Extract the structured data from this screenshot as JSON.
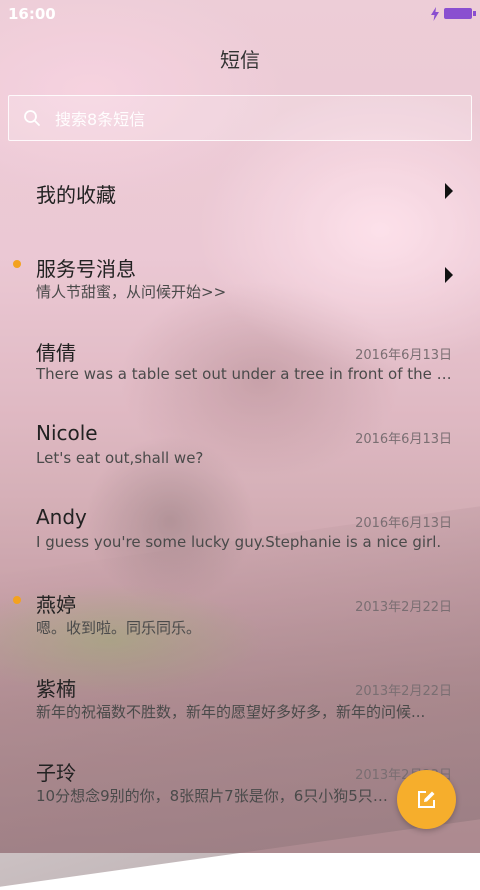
{
  "status_bar": {
    "time": "16:00"
  },
  "header": {
    "title": "短信"
  },
  "search": {
    "placeholder": "搜索8条短信"
  },
  "conversations": [
    {
      "name": "我的收藏",
      "has_arrow": true
    },
    {
      "name": "服务号消息",
      "preview": "情人节甜蜜，从问候开始>>",
      "unread": true,
      "has_arrow": true
    },
    {
      "name": "倩倩",
      "preview": "There was a table set out under a tree in front of the ho...",
      "date": "2016年6月13日"
    },
    {
      "name": "Nicole",
      "preview": "Let's eat out,shall we?",
      "date": "2016年6月13日"
    },
    {
      "name": "Andy",
      "preview": "I guess you're some lucky guy.Stephanie is a nice girl.",
      "date": "2016年6月13日"
    },
    {
      "name": "燕婷",
      "preview": "嗯。收到啦。同乐同乐。",
      "date": "2013年2月22日",
      "unread": true
    },
    {
      "name": "紫楠",
      "preview": "新年的祝福数不胜数，新年的愿望好多好多，新年的问候...",
      "date": "2013年2月22日"
    },
    {
      "name": "子玲",
      "preview": "10分想念9别的你，8张照片7张是你，6只小狗5只像你...",
      "date": "2013年2月22日"
    }
  ],
  "colors": {
    "accent": "#f6ae2c",
    "unread_dot": "#f3a21f",
    "battery": "#8a4fd0"
  },
  "icons": {
    "fab": "compose-icon",
    "search": "search-icon",
    "arrow": "chevron-right-icon"
  }
}
